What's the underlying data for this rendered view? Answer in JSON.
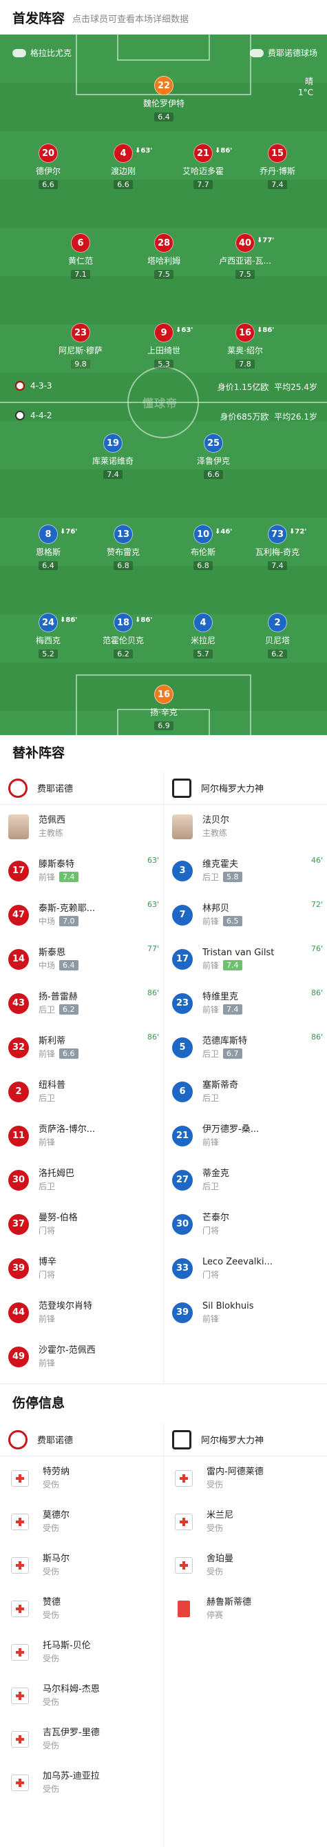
{
  "header": {
    "title": "首发阵容",
    "subtitle": "点击球员可查看本场详细数据"
  },
  "pitch": {
    "home_team": "格拉比尤克",
    "away_team": "费耶诺德球场",
    "weather": "晴",
    "temperature": "1°C",
    "watermark": "懂球帝",
    "home_formation": "4-3-3",
    "home_value": "身价1.15亿欧",
    "home_age": "平均25.4岁",
    "away_formation": "4-4-2",
    "away_value": "身价685万欧",
    "away_age": "平均26.1岁",
    "players": [
      {
        "num": "22",
        "name": "魏伦罗伊特",
        "rating": "6.4",
        "color": "org"
      },
      {
        "num": "20",
        "name": "德伊尔",
        "rating": "6.6",
        "color": "red"
      },
      {
        "num": "4",
        "name": "渡边刚",
        "rating": "6.6",
        "color": "red",
        "sub": "63'"
      },
      {
        "num": "21",
        "name": "艾哈迈多霍",
        "rating": "7.7",
        "color": "red",
        "sub": "86'"
      },
      {
        "num": "15",
        "name": "乔丹·博斯",
        "rating": "7.4",
        "color": "red"
      },
      {
        "num": "6",
        "name": "黄仁范",
        "rating": "7.1",
        "color": "red"
      },
      {
        "num": "28",
        "name": "塔哈利姆",
        "rating": "7.5",
        "color": "red"
      },
      {
        "num": "40",
        "name": "卢西亚诺-瓦...",
        "rating": "7.5",
        "color": "red",
        "sub": "77'"
      },
      {
        "num": "23",
        "name": "阿尼斯·穆萨",
        "rating": "9.8",
        "color": "red"
      },
      {
        "num": "9",
        "name": "上田绮世",
        "rating": "5.3",
        "color": "red",
        "sub": "63'"
      },
      {
        "num": "16",
        "name": "莱奥·绍尔",
        "rating": "7.8",
        "color": "red",
        "sub": "86'"
      },
      {
        "num": "19",
        "name": "库莱诺维奇",
        "rating": "7.4",
        "color": "blue"
      },
      {
        "num": "25",
        "name": "泽鲁伊克",
        "rating": "6.6",
        "color": "blue"
      },
      {
        "num": "8",
        "name": "恩格斯",
        "rating": "6.4",
        "color": "blue",
        "sub": "76'"
      },
      {
        "num": "13",
        "name": "赞布雷克",
        "rating": "6.8",
        "color": "blue"
      },
      {
        "num": "10",
        "name": "布伦斯",
        "rating": "6.8",
        "color": "blue",
        "sub": "46'"
      },
      {
        "num": "73",
        "name": "瓦利梅-奇克",
        "rating": "7.4",
        "color": "blue",
        "sub": "72'"
      },
      {
        "num": "24",
        "name": "梅西克",
        "rating": "5.2",
        "color": "blue",
        "sub": "86'"
      },
      {
        "num": "18",
        "name": "范霍伦贝克",
        "rating": "6.2",
        "color": "blue",
        "sub": "86'"
      },
      {
        "num": "4",
        "name": "米拉尼",
        "rating": "5.7",
        "color": "blue"
      },
      {
        "num": "2",
        "name": "贝尼塔",
        "rating": "6.2",
        "color": "blue"
      },
      {
        "num": "16",
        "name": "扬·辛克",
        "rating": "6.9",
        "color": "org"
      }
    ]
  },
  "subs": {
    "title": "替补阵容",
    "home_name": "费耶诺德",
    "away_name": "阿尔梅罗大力神",
    "home": [
      {
        "num": "",
        "name": "范佩西",
        "pos": "主教练",
        "coach": true
      },
      {
        "num": "17",
        "name": "滕斯泰特",
        "pos": "前锋",
        "rating": "7.4",
        "ev": "63'",
        "g": true
      },
      {
        "num": "47",
        "name": "泰斯-克赖耶...",
        "pos": "中场",
        "rating": "7.0",
        "ev": "63'"
      },
      {
        "num": "14",
        "name": "斯泰恩",
        "pos": "中场",
        "rating": "6.4",
        "ev": "77'"
      },
      {
        "num": "43",
        "name": "扬-普雷赫",
        "pos": "后卫",
        "rating": "6.2",
        "ev": "86'"
      },
      {
        "num": "32",
        "name": "斯利蒂",
        "pos": "前锋",
        "rating": "6.6",
        "ev": "86'"
      },
      {
        "num": "2",
        "name": "纽科普",
        "pos": "后卫"
      },
      {
        "num": "11",
        "name": "贡萨洛-博尔...",
        "pos": "前锋"
      },
      {
        "num": "30",
        "name": "洛托姆巴",
        "pos": "后卫"
      },
      {
        "num": "37",
        "name": "曼努-伯格",
        "pos": "门将"
      },
      {
        "num": "39",
        "name": "博辛",
        "pos": "门将"
      },
      {
        "num": "44",
        "name": "范登埃尔肖特",
        "pos": "前锋"
      },
      {
        "num": "49",
        "name": "沙霍尔-范佩西",
        "pos": "前锋"
      }
    ],
    "away": [
      {
        "num": "",
        "name": "法贝尔",
        "pos": "主教练",
        "coach": true
      },
      {
        "num": "3",
        "name": "维克霍夫",
        "pos": "后卫",
        "rating": "5.8",
        "ev": "46'"
      },
      {
        "num": "7",
        "name": "林邦贝",
        "pos": "前锋",
        "rating": "6.5",
        "ev": "72'"
      },
      {
        "num": "17",
        "name": "Tristan van Gilst",
        "pos": "前锋",
        "rating": "7.4",
        "ev": "76'",
        "g": true
      },
      {
        "num": "23",
        "name": "特维里克",
        "pos": "前锋",
        "rating": "7.4",
        "ev": "86'"
      },
      {
        "num": "5",
        "name": "范德库斯特",
        "pos": "后卫",
        "rating": "6.7",
        "ev": "86'"
      },
      {
        "num": "6",
        "name": "塞斯蒂奇",
        "pos": "后卫"
      },
      {
        "num": "21",
        "name": "伊万德罗-桑...",
        "pos": "前锋"
      },
      {
        "num": "27",
        "name": "蒂金克",
        "pos": "后卫"
      },
      {
        "num": "30",
        "name": "芒泰尔",
        "pos": "门将"
      },
      {
        "num": "33",
        "name": "Leco Zeevalki...",
        "pos": "门将"
      },
      {
        "num": "39",
        "name": "Sil Blokhuis",
        "pos": "前锋"
      }
    ]
  },
  "injury": {
    "title": "伤停信息",
    "home_name": "费耶诺德",
    "away_name": "阿尔梅罗大力神",
    "home": [
      {
        "name": "特劳纳",
        "status": "受伤"
      },
      {
        "name": "莫德尔",
        "status": "受伤"
      },
      {
        "name": "斯马尔",
        "status": "受伤"
      },
      {
        "name": "赞德",
        "status": "受伤"
      },
      {
        "name": "托马斯-贝伦",
        "status": "受伤"
      },
      {
        "name": "马尔科姆-杰恩",
        "status": "受伤"
      },
      {
        "name": "吉瓦伊罗-里德",
        "status": "受伤"
      },
      {
        "name": "加乌苏-迪亚拉",
        "status": "受伤"
      }
    ],
    "away": [
      {
        "name": "雷内-阿德莱德",
        "status": "受伤"
      },
      {
        "name": "米兰尼",
        "status": "受伤"
      },
      {
        "name": "舍珀曼",
        "status": "受伤"
      },
      {
        "name": "赫鲁斯蒂德",
        "status": "停赛",
        "card": true
      }
    ]
  },
  "colors": {
    "home": "#d0121b",
    "away": "#1f67c4",
    "keeper": "#f07b1e",
    "pitch": "#3f9a4d"
  }
}
